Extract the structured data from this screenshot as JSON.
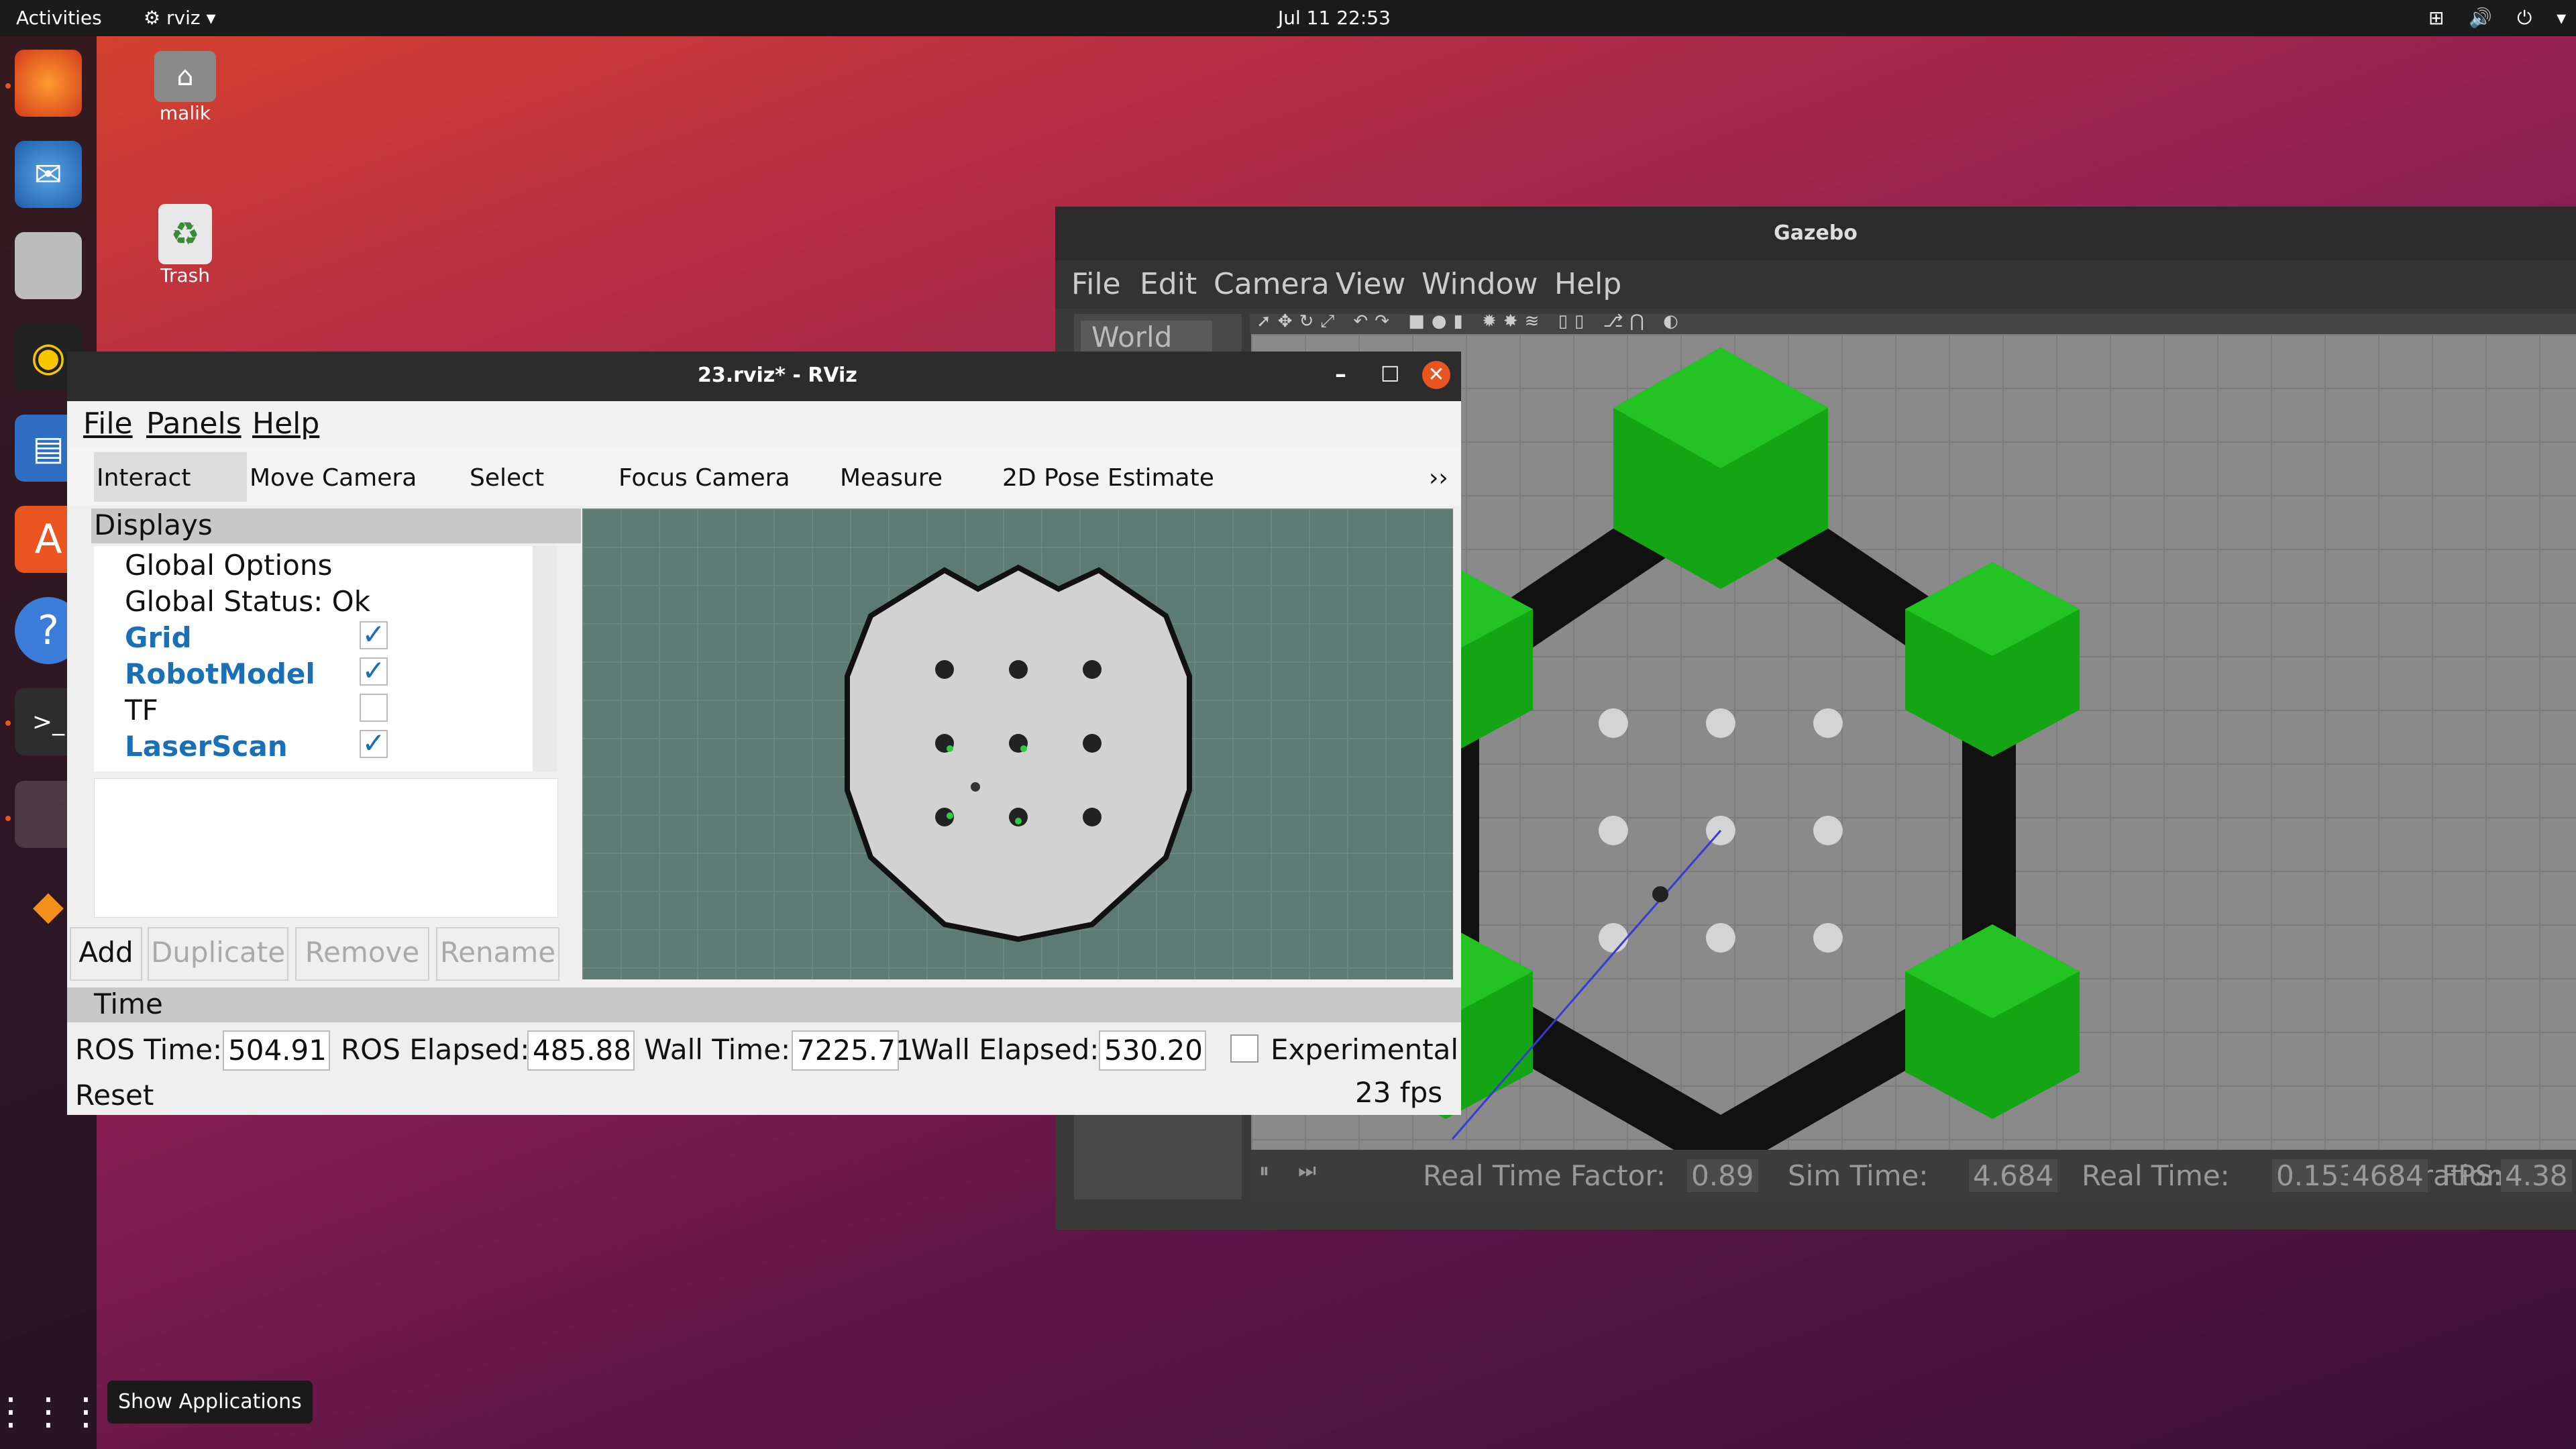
{
  "topbar": {
    "activities": "Activities",
    "app_name": "rviz",
    "clock": "Jul 11  22:53"
  },
  "desktop": {
    "home_label": "malik",
    "trash_label": "Trash"
  },
  "dock": {
    "show_apps_tooltip": "Show Applications"
  },
  "gazebo": {
    "title": "Gazebo",
    "menu": [
      "File",
      "Edit",
      "Camera",
      "View",
      "Window",
      "Help"
    ],
    "side_tab": "World",
    "status": {
      "rtf_label": "Real Time Factor:",
      "rtf": "0.89",
      "sim_label": "Sim Time:",
      "sim": "4.684",
      "real_label": "Real Time:",
      "real": "0.153",
      "iter_label": "Iterations:",
      "iter": "4684",
      "fps_label": "FPS:",
      "fps": "4.38"
    }
  },
  "rviz": {
    "title": "23.rviz* - RViz",
    "menu": [
      "File",
      "Panels",
      "Help"
    ],
    "tools": [
      "Interact",
      "Move Camera",
      "Select",
      "Focus Camera",
      "Measure",
      "2D Pose Estimate"
    ],
    "more": "››",
    "displays_title": "Displays",
    "displays": [
      {
        "label": "Global Options",
        "checked": null
      },
      {
        "label": "Global Status: Ok",
        "checked": null
      },
      {
        "label": "Grid",
        "checked": "✓"
      },
      {
        "label": "RobotModel",
        "checked": "✓"
      },
      {
        "label": "TF",
        "checked": ""
      },
      {
        "label": "LaserScan",
        "checked": "✓"
      }
    ],
    "buttons": [
      "Add",
      "Duplicate",
      "Remove",
      "Rename"
    ],
    "time_title": "Time",
    "time": {
      "ros_time_label": "ROS Time:",
      "ros_time": "504.91",
      "ros_elapsed_label": "ROS Elapsed:",
      "ros_elapsed": "485.88",
      "wall_time_label": "Wall Time:",
      "wall_time": "7225.71",
      "wall_elapsed_label": "Wall Elapsed:",
      "wall_elapsed": "530.20",
      "experimental": "Experimental"
    },
    "reset": "Reset",
    "fps": "23 fps"
  },
  "colors": {
    "ubuntu_orange": "#e95420",
    "gazebo_green": "#119911",
    "link_blue": "#1b6fb5"
  }
}
